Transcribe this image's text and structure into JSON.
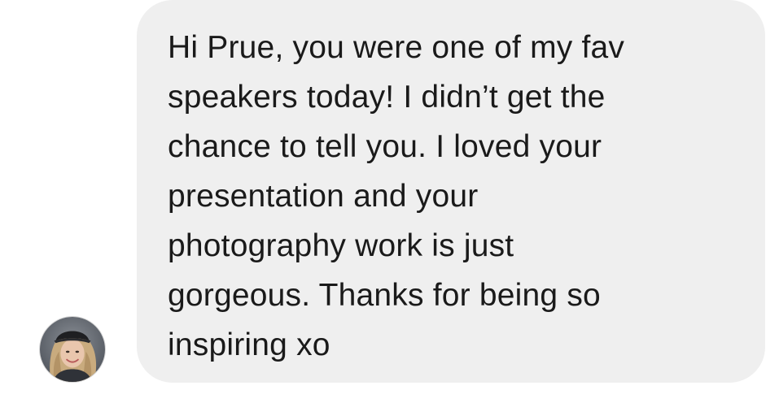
{
  "conversation": {
    "incoming_message": {
      "text": "Hi Prue, you were one of my fav\nspeakers today! I didn’t get the\nchance to tell you. I loved your\npresentation and your\nphotography work is just\ngorgeous. Thanks for being so\ninspiring xo",
      "sender_avatar_icon": "user-avatar-photo"
    }
  },
  "colors": {
    "bubble_background": "#efefef",
    "text": "#1a1a1a",
    "page_background": "#ffffff"
  }
}
